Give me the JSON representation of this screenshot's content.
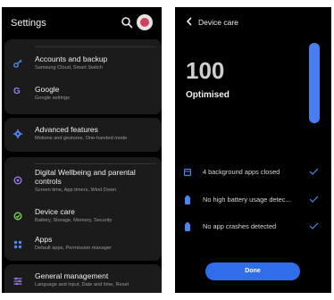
{
  "settings": {
    "title": "Settings",
    "groups": [
      {
        "items": [
          {
            "icon": "key-icon",
            "title": "Accounts and backup",
            "subtitle": "Samsung Cloud, Smart Switch"
          },
          {
            "icon": "google-icon",
            "icon_glyph": "G",
            "title": "Google",
            "subtitle": "Google settings"
          }
        ]
      },
      {
        "items": [
          {
            "icon": "advanced-features-icon",
            "title": "Advanced features",
            "subtitle": "Motions and gestures, One-handed mode"
          }
        ]
      },
      {
        "items": [
          {
            "icon": "digital-wellbeing-icon",
            "title": "Digital Wellbeing and parental controls",
            "subtitle": "Screen time, App timers, Wind Down"
          },
          {
            "icon": "device-care-icon",
            "title": "Device care",
            "subtitle": "Battery, Storage, Memory, Security"
          },
          {
            "icon": "apps-icon",
            "title": "Apps",
            "subtitle": "Default apps, Permission manager"
          }
        ]
      },
      {
        "items": [
          {
            "icon": "general-management-icon",
            "title": "General management",
            "subtitle": "Language and input, Date and time, Reset"
          }
        ]
      }
    ]
  },
  "device_care": {
    "title": "Device care",
    "score": "100",
    "score_label": "Optimised",
    "score_level_percent": 100,
    "checks": [
      {
        "icon": "background-apps-icon",
        "text": "4 background apps closed"
      },
      {
        "icon": "battery-icon",
        "text": "No high battery usage detec..."
      },
      {
        "icon": "battery-icon",
        "text": "No app crashes detected"
      }
    ],
    "done_label": "Done"
  },
  "colors": {
    "accent": "#2f6ee8",
    "progress": "#4a7df2",
    "icon_blue": "#4a86f5",
    "icon_purple": "#a07bf0",
    "icon_green": "#7bd94a",
    "background": "#000000",
    "card": "#1b1b1b"
  }
}
